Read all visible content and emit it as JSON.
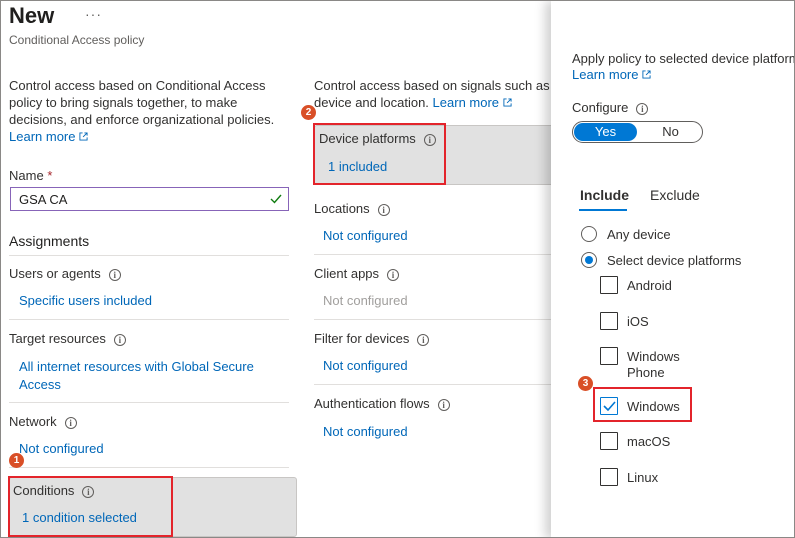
{
  "header": {
    "title": "New",
    "more": "···",
    "subtitle": "Conditional Access policy"
  },
  "left": {
    "description": "Control access based on Conditional Access policy to bring signals together, to make decisions, and enforce organizational policies.",
    "learn_more": "Learn more",
    "name_label": "Name",
    "required_mark": "*",
    "name_value": "GSA CA",
    "assignments_heading": "Assignments",
    "users_label": "Users or agents",
    "users_value": "Specific users included",
    "target_label": "Target resources",
    "target_value": "All internet resources with Global Secure Access",
    "network_label": "Network",
    "network_value": "Not configured",
    "conditions_label": "Conditions",
    "conditions_value": "1 condition selected"
  },
  "middle": {
    "description_line1": "Control access based on signals such as ri",
    "description_line2": "device and location.",
    "learn_more": "Learn more",
    "device_platforms_label": "Device platforms",
    "device_platforms_value": "1 included",
    "locations_label": "Locations",
    "locations_value": "Not configured",
    "client_apps_label": "Client apps",
    "client_apps_value": "Not configured",
    "filter_label": "Filter for devices",
    "filter_value": "Not configured",
    "auth_flows_label": "Authentication flows",
    "auth_flows_value": "Not configured"
  },
  "panel": {
    "description": "Apply policy to selected device platform",
    "learn_more": "Learn more",
    "configure_label": "Configure",
    "toggle_yes": "Yes",
    "toggle_no": "No",
    "tab_include": "Include",
    "tab_exclude": "Exclude",
    "radio_any": "Any device",
    "radio_select": "Select device platforms",
    "platforms": {
      "android": "Android",
      "ios": "iOS",
      "windows_phone_1": "Windows",
      "windows_phone_2": "Phone",
      "windows": "Windows",
      "macos": "macOS",
      "linux": "Linux"
    }
  },
  "steps": {
    "one": "1",
    "two": "2",
    "three": "3"
  },
  "colors": {
    "accent": "#0078d4",
    "link": "#0067b8",
    "highlight": "#e3242b",
    "step_badge": "#d94f27",
    "valid_check": "#107c10"
  }
}
